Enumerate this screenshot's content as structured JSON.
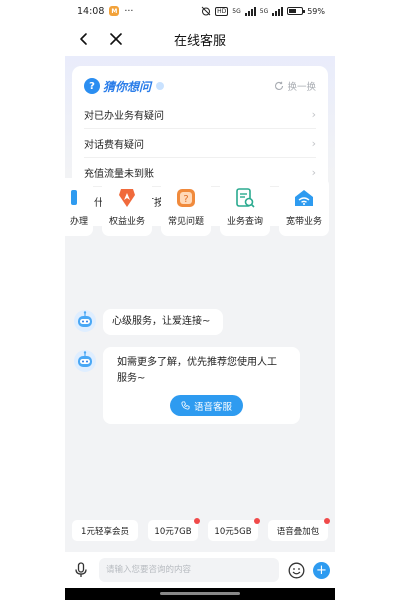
{
  "status_bar": {
    "time": "14:08",
    "dots": "···",
    "net_label": "HD",
    "signal_1_label": "5G",
    "signal_2_label": "5G",
    "battery_percent": "59%",
    "battery_level": 0.59
  },
  "nav": {
    "title": "在线客服",
    "back_icon": "arrow-left-icon",
    "close_icon": "close-icon"
  },
  "guess": {
    "title": "猜你想问",
    "refresh_label": "换一换",
    "questions": [
      "对已办业务有疑问",
      "对话费有疑问",
      "充值流量未到账",
      "为什么没有退订按钮"
    ]
  },
  "quick_services": [
    {
      "label": "办理",
      "icon": "handle-icon"
    },
    {
      "label": "权益业务",
      "icon": "medal-icon"
    },
    {
      "label": "常见问题",
      "icon": "question-icon"
    },
    {
      "label": "业务查询",
      "icon": "document-search-icon"
    },
    {
      "label": "宽带业务",
      "icon": "wifi-router-icon"
    }
  ],
  "messages": [
    {
      "text": "心级服务，让爱连接~"
    },
    {
      "text": "如需更多了解，优先推荐您使用人工服务~",
      "button_label": "语音客服"
    }
  ],
  "chips": [
    {
      "label": "1元轻享会员"
    },
    {
      "label": "10元7GB"
    },
    {
      "label": "10元5GB"
    },
    {
      "label": "语音叠加包"
    }
  ],
  "input": {
    "placeholder": "请输入您要咨询的内容"
  },
  "colors": {
    "accent": "#2e9bf0",
    "badge_red": "#f04a4a",
    "background": "#f2f3f5"
  }
}
